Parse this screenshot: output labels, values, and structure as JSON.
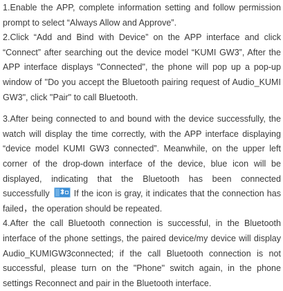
{
  "document": {
    "step1": "1.Enable the APP, complete information setting and follow permission prompt to select “Always Allow and Approve”.",
    "step2": "2.Click “Add and Bind with Device” on the APP interface and click “Connect” after searching out the device model “KUMI GW3”, After the APP interface displays \"Connected\", the phone will pop up a pop-up window of \"Do you accept the Bluetooth pairing request of Audio_KUMI GW3\", click \"Pair\" to call Bluetooth.",
    "step3_before_icon": "3.After being connected to and bound with the device successfully, the watch will display the time correctly, with the APP interface displaying “device model KUMI GW3 connected”. Meanwhile, on the upper left corner of the drop-down interface of the device, blue icon will be displayed, indicating that the Bluetooth has been connected successfully",
    "step3_after_icon": " If the icon is gray, it indicates that the connection has failed，the operation should be repeated.",
    "step4": "4.After the call Bluetooth connection is successful, in the Bluetooth interface of the phone settings, the paired device/my device will display Audio_KUMIGW3connected; if the call Bluetooth connection is not successful, please turn on the \"Phone\" switch again, in the phone settings Reconnect and pair in the Bluetooth interface."
  },
  "icons": {
    "bluetooth_status_icon": {
      "name": "bluetooth-connected-icon",
      "color": "#3d8fd6"
    }
  },
  "colors": {
    "text": "#3a3a3a",
    "background": "#ffffff"
  }
}
